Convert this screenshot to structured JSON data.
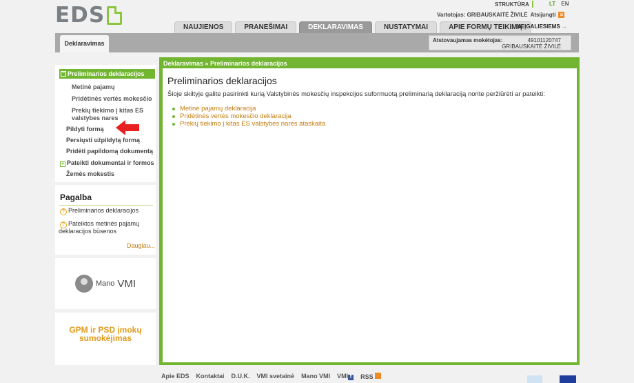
{
  "logo": {
    "text": "EDS"
  },
  "top": {
    "structure": "STRUKTŪRA",
    "lang_lt": "LT",
    "lang_en": "EN",
    "user_label": "Vartotojas: GRIBAUSKAITĖ ŽIVILĖ",
    "logout": "Atsijungti"
  },
  "tabs": [
    "NAUJIENOS",
    "PRANEŠIMAI",
    "DEKLARAVIMAS",
    "NUSTATYMAI",
    "APIE FORMŲ TEIKIMĄ"
  ],
  "active_tab": "DEKLARAVIMAS",
  "negaliesiems": "NEĮGALIESIEMS",
  "subtab": "Deklaravimas",
  "represented": {
    "label": "Atstovaujamas mokėtojas:",
    "code": "49101120747",
    "name": "GRIBAUSKAITĖ ŽIVILĖ"
  },
  "sidebar": {
    "active": "Preliminarios deklaracijos",
    "sub_items": [
      "Metinė pajamų",
      "Pridėtinės vertės mokesčio",
      "Prekių tiekimo į kitas ES",
      "valstybes nares"
    ],
    "items": [
      "Pildyti formą",
      "Persiųsti užpildytą formą",
      "Pridėti papildomą dokumentą",
      "Pateikti dokumentai ir formos",
      "Žemės mokestis"
    ]
  },
  "help": {
    "title": "Pagalba",
    "links": [
      "Preliminarios deklaracijos",
      "Pateiktos metinės pajamų",
      "deklaracijos būsenos"
    ],
    "more": "Daugiau..."
  },
  "vmi": {
    "mano": "Mano",
    "vmi": "VMI"
  },
  "gpm": {
    "line1": "GPM ir PSD įmokų",
    "line2": "sumokėjimas"
  },
  "main": {
    "breadcrumb": "Deklaravimas » Preliminarios deklaracijos",
    "title": "Preliminarios deklaracijos",
    "intro": "Šioje skiltyje galite pasirinkti kurią Valstybinės mokesčių inspekcijos suformuotą preliminarią deklaraciją norite peržiūrėti ar pateikti:",
    "links": [
      "Metinė pajamų deklaracija",
      "Pridėtinės vertės mokesčio deklaracija",
      "Prekių tiekimo į kitas ES valstybes nares ataskaita"
    ]
  },
  "footer": [
    "Apie EDS",
    "Kontaktai",
    "D.U.K.",
    "VMI svetainė",
    "Mano VMI",
    "VMI",
    "RSS"
  ],
  "colors": {
    "green": "#71b530",
    "orange": "#c27c0e",
    "gray_bar": "#a9a9a9"
  }
}
